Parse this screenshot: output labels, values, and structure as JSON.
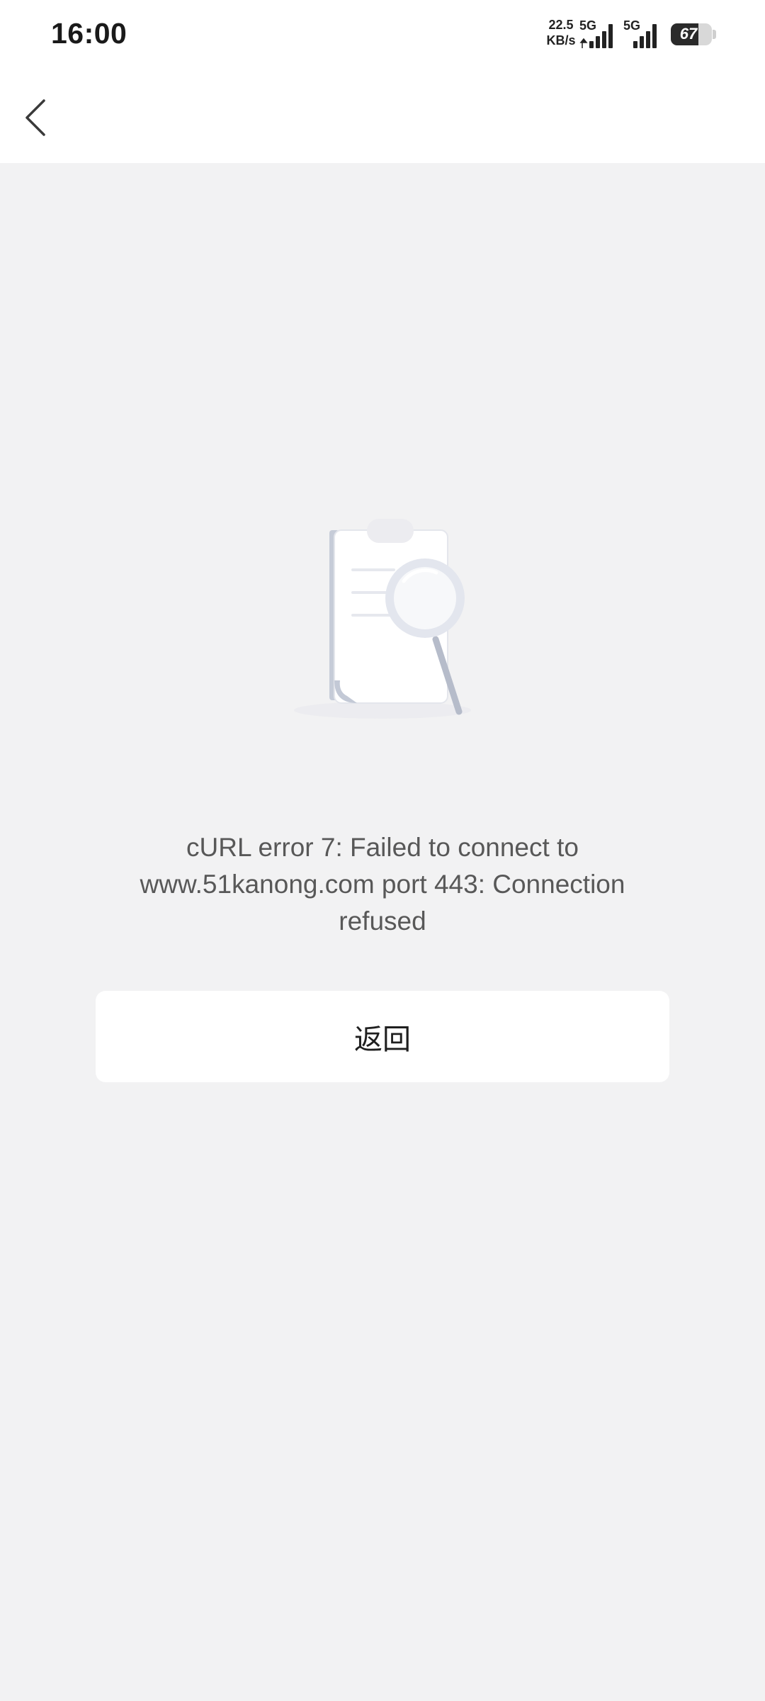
{
  "status_bar": {
    "time": "16:00",
    "net_speed_value": "22.5",
    "net_speed_unit": "KB/s",
    "sim1_label": "5G",
    "sim2_label": "5G",
    "battery_level": "67",
    "battery_fraction": 0.67
  },
  "nav": {
    "back_icon": "chevron-left-icon"
  },
  "empty_state": {
    "illustration_icon": "clipboard-magnifier-icon",
    "message": "cURL error 7: Failed to connect to www.51kanong.com port 443: Connection refused",
    "button_label": "返回"
  },
  "colors": {
    "page_background": "#f2f2f3",
    "surface": "#ffffff",
    "message_text": "#585858",
    "button_text": "#1f1f1f"
  }
}
